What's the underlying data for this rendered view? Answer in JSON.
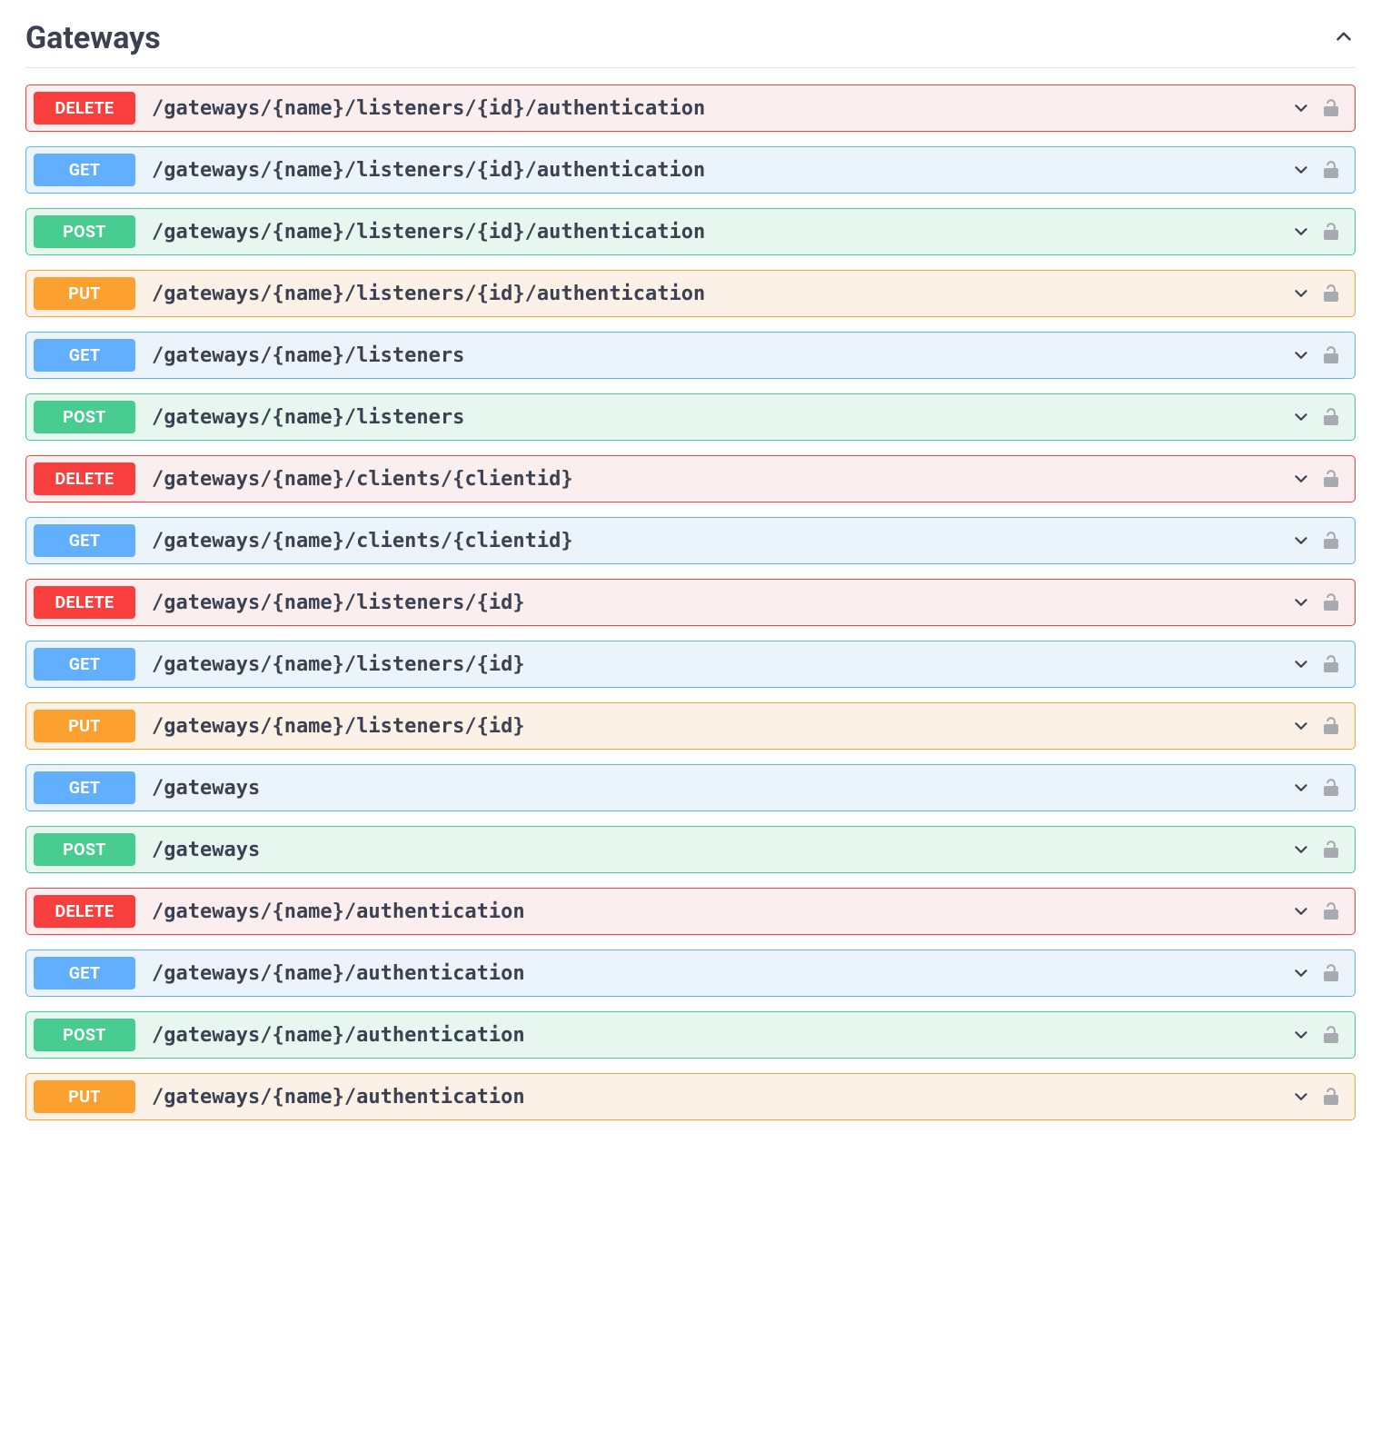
{
  "section": {
    "title": "Gateways"
  },
  "endpoints": [
    {
      "method": "DELETE",
      "path": "/gateways/{name}/listeners/{id}/authentication"
    },
    {
      "method": "GET",
      "path": "/gateways/{name}/listeners/{id}/authentication"
    },
    {
      "method": "POST",
      "path": "/gateways/{name}/listeners/{id}/authentication"
    },
    {
      "method": "PUT",
      "path": "/gateways/{name}/listeners/{id}/authentication"
    },
    {
      "method": "GET",
      "path": "/gateways/{name}/listeners"
    },
    {
      "method": "POST",
      "path": "/gateways/{name}/listeners"
    },
    {
      "method": "DELETE",
      "path": "/gateways/{name}/clients/{clientid}"
    },
    {
      "method": "GET",
      "path": "/gateways/{name}/clients/{clientid}"
    },
    {
      "method": "DELETE",
      "path": "/gateways/{name}/listeners/{id}"
    },
    {
      "method": "GET",
      "path": "/gateways/{name}/listeners/{id}"
    },
    {
      "method": "PUT",
      "path": "/gateways/{name}/listeners/{id}"
    },
    {
      "method": "GET",
      "path": "/gateways"
    },
    {
      "method": "POST",
      "path": "/gateways"
    },
    {
      "method": "DELETE",
      "path": "/gateways/{name}/authentication"
    },
    {
      "method": "GET",
      "path": "/gateways/{name}/authentication"
    },
    {
      "method": "POST",
      "path": "/gateways/{name}/authentication"
    },
    {
      "method": "PUT",
      "path": "/gateways/{name}/authentication"
    }
  ]
}
